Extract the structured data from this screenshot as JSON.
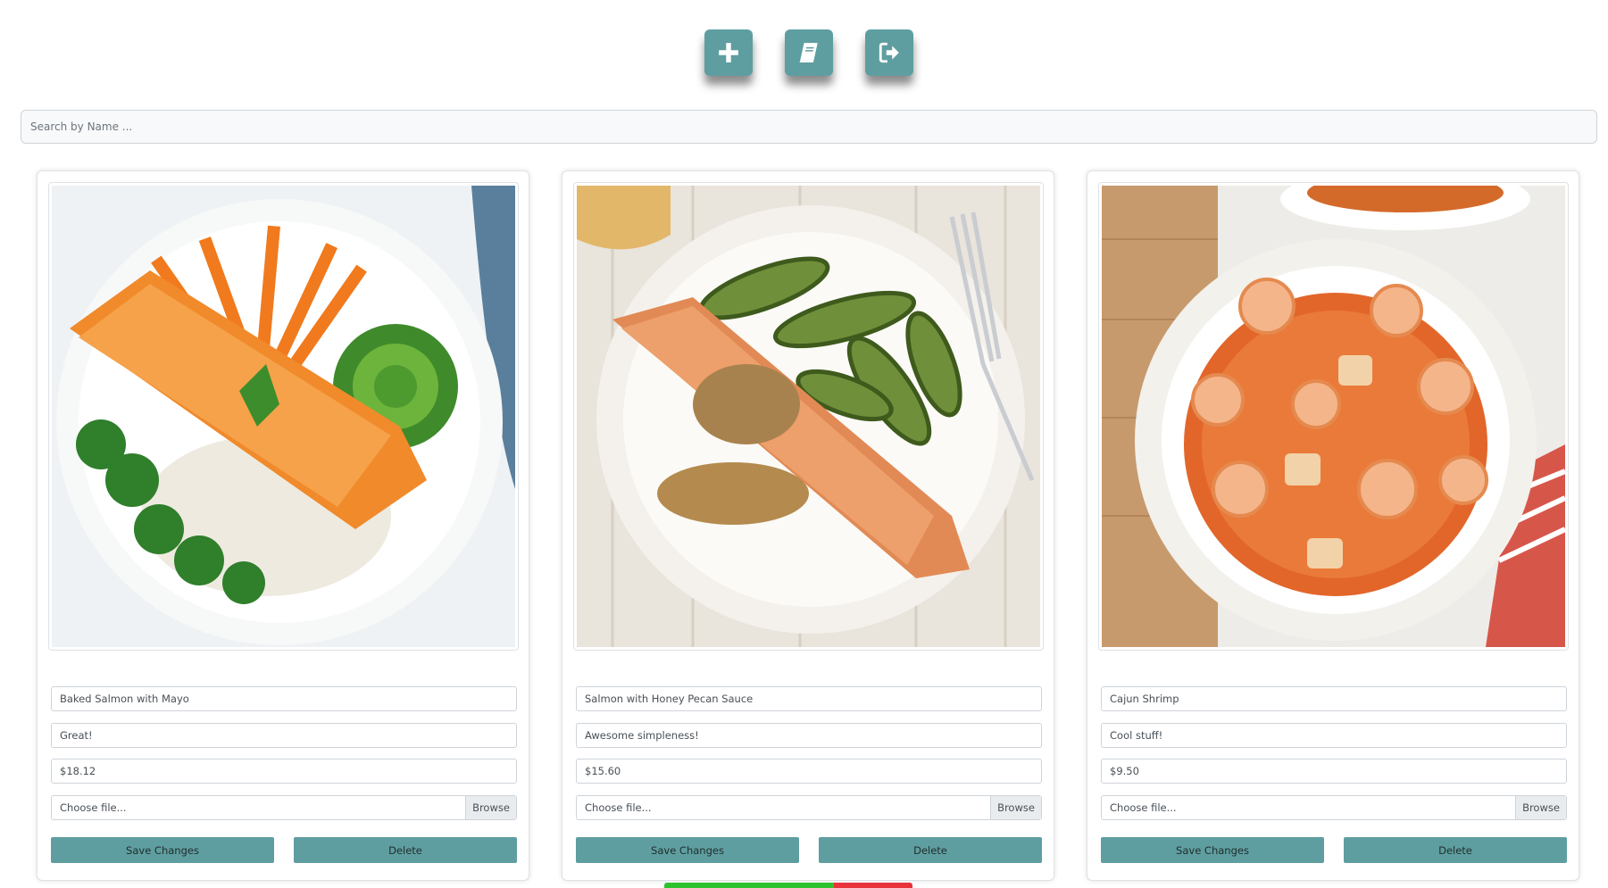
{
  "toolbar": {
    "buttons": [
      {
        "icon": "plus-icon"
      },
      {
        "icon": "book-icon"
      },
      {
        "icon": "sign-out-icon"
      }
    ]
  },
  "search": {
    "placeholder": "Search by Name ...",
    "value": ""
  },
  "cards": [
    {
      "image": "salmon-rice-avocado-dish",
      "name": "Baked Salmon with Mayo",
      "description": "Great!",
      "price": "$18.12",
      "file_label": "Choose file...",
      "browse_label": "Browse",
      "save_label": "Save Changes",
      "delete_label": "Delete"
    },
    {
      "image": "salmon-honey-pecan-zucchini-dish",
      "name": "Salmon with Honey Pecan Sauce",
      "description": "Awesome simpleness!",
      "price": "$15.60",
      "file_label": "Choose file...",
      "browse_label": "Browse",
      "save_label": "Save Changes",
      "delete_label": "Delete"
    },
    {
      "image": "cajun-shrimp-stew-dish",
      "name": "Cajun Shrimp",
      "description": "Cool stuff!",
      "price": "$9.50",
      "file_label": "Choose file...",
      "browse_label": "Browse",
      "save_label": "Save Changes",
      "delete_label": "Delete"
    }
  ],
  "colors": {
    "accent": "#5f9ea0",
    "status_ok": "#2fc22f",
    "status_error": "#e8323c"
  }
}
